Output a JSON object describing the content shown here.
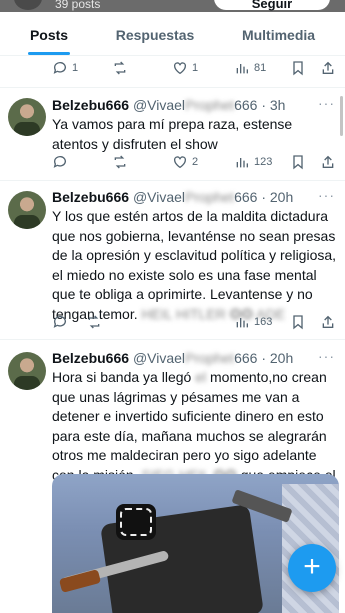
{
  "header": {
    "posts_count": "39 posts",
    "follow_label": "Seguir"
  },
  "tabs": [
    {
      "label": "Posts",
      "active": true
    },
    {
      "label": "Respuestas",
      "active": false
    },
    {
      "label": "Multimedia",
      "active": false
    }
  ],
  "top_actions": {
    "reply_count": "1",
    "like_count": "1",
    "views": "81"
  },
  "tweets": [
    {
      "name": "Belzebu666",
      "handle_pre": "@Vivael",
      "handle_post": "666",
      "time": "3h",
      "text_a": "Ya vamos para mí prepa ",
      "text_b": "raza, estense atentos y disfruten el show",
      "reply_count": "",
      "retweet_count": "",
      "like_count": "2",
      "views": "123"
    },
    {
      "name": "Belzebu666",
      "handle_pre": "@Vivael",
      "handle_post": "666",
      "time": "20h",
      "text_a": "Y los que estén artos de la maldita dictadura que nos gobierna, levanténse no sean presas de la opresión y esclavitud política y religiosa, el miedo no existe solo es una fase mental que te obliga a oprimirte. Levantense y no tengan temor.",
      "text_b": "",
      "reply_count": "",
      "retweet_count": "",
      "like_count": "",
      "views": "163"
    },
    {
      "name": "Belzebu666",
      "handle_pre": "@Vivael",
      "handle_post": "666",
      "time": "20h",
      "text_a": "Hora si banda ya llegó ",
      "text_b": "momento,no crean que unas lágrimas y pésames me van a detener e invertido suficiente dinero en esto para este día, mañana muchos se alegrarán otros me maldeciran pero yo sigo adelante con la misión.",
      "text_c": "que empiece el show",
      "reply_count": "",
      "retweet_count": "",
      "like_count": "",
      "views": ""
    }
  ],
  "colors": {
    "accent": "#1d9bf0",
    "text": "#0f1419",
    "muted": "#536471"
  },
  "fab_icon": "plus-icon"
}
